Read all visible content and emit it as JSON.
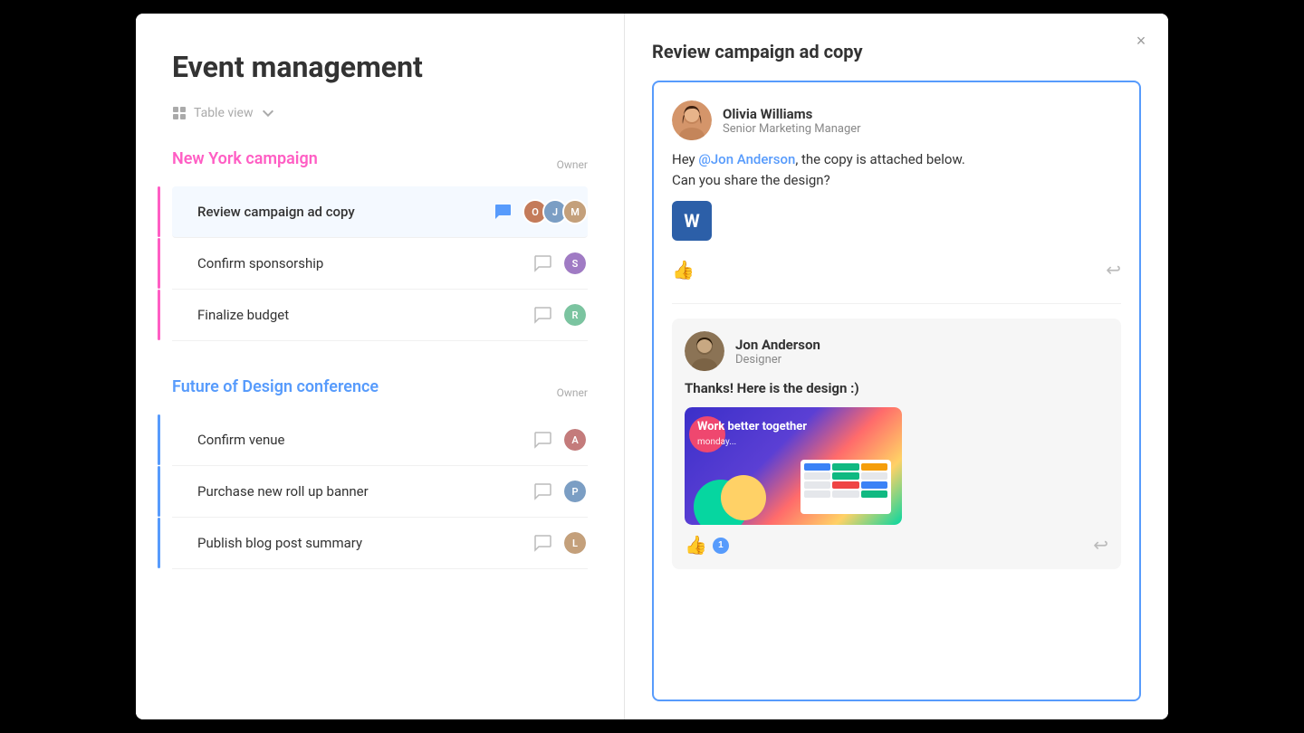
{
  "page": {
    "title": "Event management",
    "close_label": "×"
  },
  "left": {
    "table_view_label": "Table view",
    "sections": [
      {
        "id": "new-york",
        "title": "New York campaign",
        "color": "pink",
        "owner_label": "Owner",
        "tasks": [
          {
            "id": "t1",
            "name": "Review campaign ad copy",
            "active": true,
            "bar_color": "pink",
            "chat_active": true
          },
          {
            "id": "t2",
            "name": "Confirm sponsorship",
            "active": false,
            "bar_color": "pink",
            "chat_active": false
          },
          {
            "id": "t3",
            "name": "Finalize budget",
            "active": false,
            "bar_color": "pink",
            "chat_active": false
          }
        ]
      },
      {
        "id": "future-design",
        "title": "Future of Design conference",
        "color": "blue",
        "owner_label": "Owner",
        "tasks": [
          {
            "id": "t4",
            "name": "Confirm venue",
            "active": false,
            "bar_color": "blue",
            "chat_active": false
          },
          {
            "id": "t5",
            "name": "Purchase new roll up banner",
            "active": false,
            "bar_color": "blue",
            "chat_active": false
          },
          {
            "id": "t6",
            "name": "Publish blog post summary",
            "active": false,
            "bar_color": "blue",
            "chat_active": false
          }
        ]
      }
    ]
  },
  "right": {
    "panel_title": "Review campaign ad copy",
    "comments": [
      {
        "id": "c1",
        "author": "Olivia Williams",
        "role": "Senior Marketing Manager",
        "body_before_mention": "Hey ",
        "mention": "@Jon Anderson",
        "body_after": ", the copy is attached below.\nCan you share the design?",
        "has_attachment": true,
        "attachment_label": "W",
        "like_count": null,
        "avatar_color": "#c47b5a"
      },
      {
        "id": "c2",
        "author": "Jon Anderson",
        "role": "Designer",
        "reply_text": "Thanks! Here is the design :)",
        "like_count": "1",
        "avatar_color": "#7b6e5a"
      }
    ],
    "like_icon": "👍",
    "reply_icon": "↩",
    "design_headline": "Work better together",
    "design_logo": "monday..."
  }
}
